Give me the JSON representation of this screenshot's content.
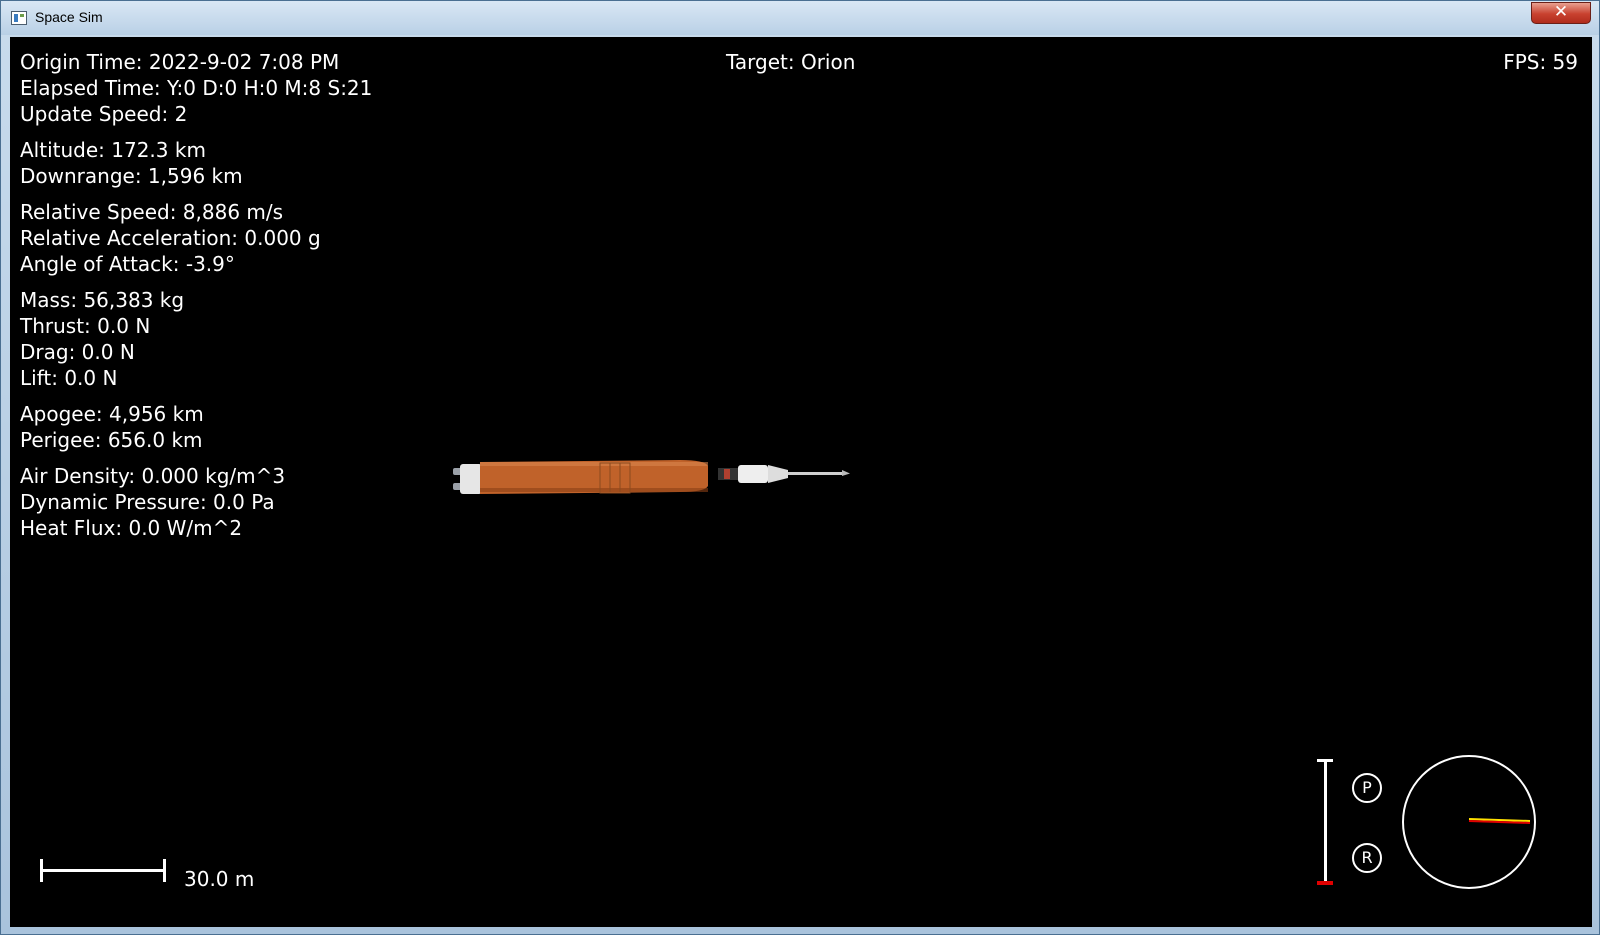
{
  "window": {
    "title": "Space Sim",
    "close_label": "✕"
  },
  "hud": {
    "origin_time": "Origin Time: 2022-9-02 7:08 PM",
    "elapsed_time": "Elapsed Time: Y:0 D:0 H:0 M:8 S:21",
    "update_speed": "Update Speed: 2",
    "altitude": "Altitude: 172.3 km",
    "downrange": "Downrange: 1,596 km",
    "relative_speed": "Relative Speed: 8,886 m/s",
    "relative_acceleration": "Relative Acceleration: 0.000 g",
    "angle_of_attack": "Angle of Attack: -3.9°",
    "mass": "Mass: 56,383 kg",
    "thrust": "Thrust: 0.0 N",
    "drag": "Drag: 0.0 N",
    "lift": "Lift: 0.0 N",
    "apogee": "Apogee: 4,956 km",
    "perigee": "Perigee: 656.0 km",
    "air_density": "Air Density: 0.000 kg/m^3",
    "dynamic_pressure": "Dynamic Pressure: 0.0 Pa",
    "heat_flux": "Heat Flux: 0.0 W/m^2",
    "target": "Target: Orion",
    "fps": "FPS: 59"
  },
  "scale": {
    "label": "30.0 m"
  },
  "controls": {
    "prograde_label": "P",
    "retrograde_label": "R",
    "throttle_level": 0.03
  },
  "colors": {
    "background": "#000000",
    "text": "#ffffff",
    "core_stage": "#c0622a",
    "throttle_fill": "#e00000",
    "heading_red": "#e00000",
    "heading_yellow": "#ffe000"
  }
}
